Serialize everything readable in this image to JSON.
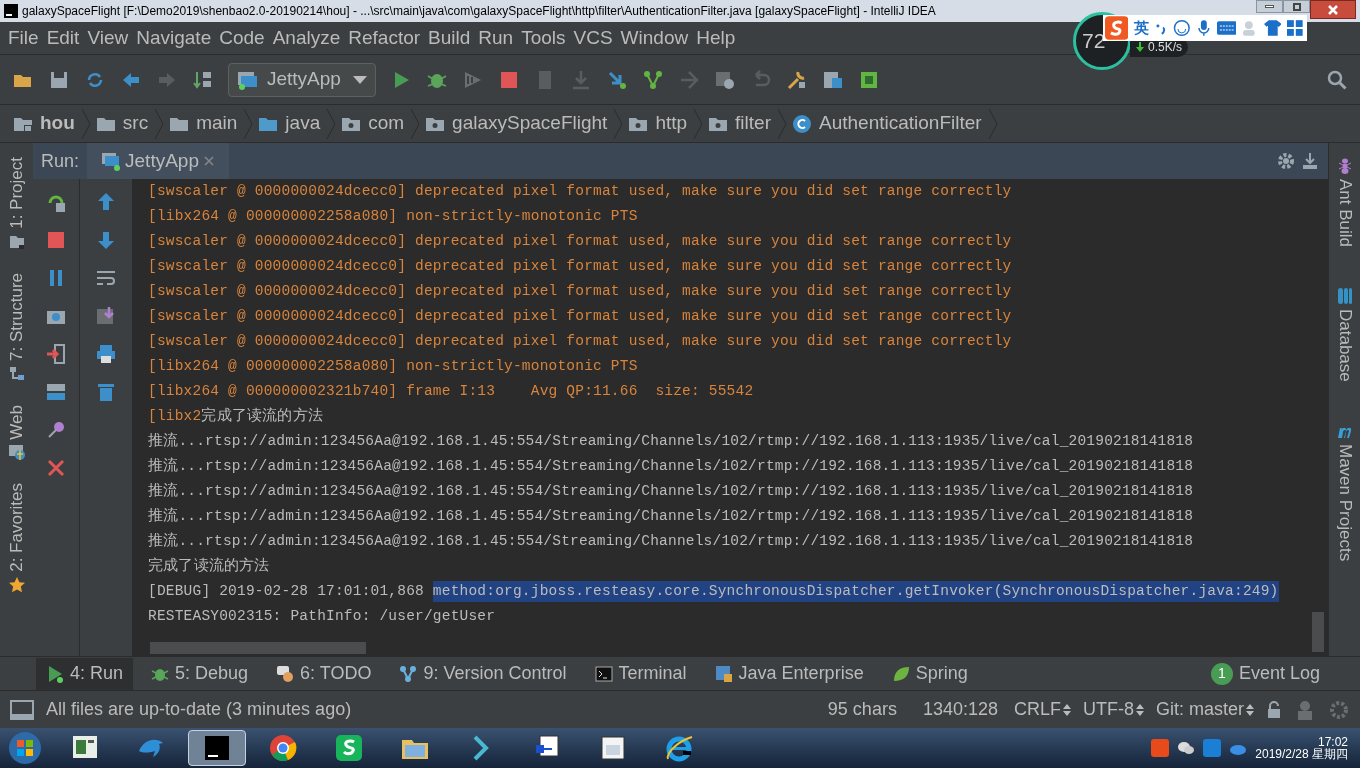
{
  "window": {
    "title": "galaxySpaceFlight [F:\\Demo2019\\shenbao2.0-20190214\\hou] - ...\\src\\main\\java\\com\\galaxySpaceFlight\\http\\filter\\AuthenticationFilter.java [galaxySpaceFlight] - IntelliJ IDEA"
  },
  "menu": [
    "File",
    "Edit",
    "View",
    "Navigate",
    "Code",
    "Analyze",
    "Refactor",
    "Build",
    "Run",
    "Tools",
    "VCS",
    "Window",
    "Help"
  ],
  "run_config": "JettyApp",
  "breadcrumbs": [
    {
      "label": "hou",
      "kind": "module"
    },
    {
      "label": "src",
      "kind": "folder"
    },
    {
      "label": "main",
      "kind": "folder"
    },
    {
      "label": "java",
      "kind": "source"
    },
    {
      "label": "com",
      "kind": "package"
    },
    {
      "label": "galaxySpaceFlight",
      "kind": "package"
    },
    {
      "label": "http",
      "kind": "package"
    },
    {
      "label": "filter",
      "kind": "package"
    },
    {
      "label": "AuthenticationFilter",
      "kind": "class"
    }
  ],
  "left_tools": [
    {
      "label": "1: Project",
      "kind": "project"
    },
    {
      "label": "7: Structure",
      "kind": "structure"
    },
    {
      "label": "Web",
      "kind": "web"
    },
    {
      "label": "2: Favorites",
      "kind": "favorites"
    }
  ],
  "right_tools": [
    {
      "label": "Ant Build",
      "kind": "ant"
    },
    {
      "label": "Database",
      "kind": "database"
    },
    {
      "label": "Maven Projects",
      "kind": "maven"
    }
  ],
  "run_panel": {
    "label": "Run:",
    "tab": "JettyApp",
    "lines": [
      {
        "parts": [
          {
            "kind": "error",
            "text": "[swscaler @ 0000000024dcecc0] deprecated pixel format used, make sure you did set range correctly"
          }
        ]
      },
      {
        "parts": [
          {
            "kind": "error",
            "text": "[libx264 @ 000000002258a080] non-strictly-monotonic PTS"
          }
        ]
      },
      {
        "parts": [
          {
            "kind": "error",
            "text": "[swscaler @ 0000000024dcecc0] deprecated pixel format used, make sure you did set range correctly"
          }
        ]
      },
      {
        "parts": [
          {
            "kind": "error",
            "text": "[swscaler @ 0000000024dcecc0] deprecated pixel format used, make sure you did set range correctly"
          }
        ]
      },
      {
        "parts": [
          {
            "kind": "error",
            "text": "[swscaler @ 0000000024dcecc0] deprecated pixel format used, make sure you did set range correctly"
          }
        ]
      },
      {
        "parts": [
          {
            "kind": "error",
            "text": "[swscaler @ 0000000024dcecc0] deprecated pixel format used, make sure you did set range correctly"
          }
        ]
      },
      {
        "parts": [
          {
            "kind": "error",
            "text": "[swscaler @ 0000000024dcecc0] deprecated pixel format used, make sure you did set range correctly"
          }
        ]
      },
      {
        "parts": [
          {
            "kind": "error",
            "text": "[libx264 @ 000000002258a080] non-strictly-monotonic PTS"
          }
        ]
      },
      {
        "parts": [
          {
            "kind": "error",
            "text": "[libx264 @ 000000002321b740] frame I:13    Avg QP:11.66  size: 55542"
          }
        ]
      },
      {
        "parts": [
          {
            "kind": "error",
            "text": "[libx2"
          },
          {
            "kind": "normal",
            "text": "完成了读流的方法"
          }
        ]
      },
      {
        "parts": [
          {
            "kind": "normal",
            "text": "推流...rtsp://admin:123456Aa@192.168.1.45:554/Streaming/Channels/102/rtmp://192.168.1.113:1935/live/cal_20190218141818"
          }
        ]
      },
      {
        "parts": [
          {
            "kind": "normal",
            "text": "推流...rtsp://admin:123456Aa@192.168.1.45:554/Streaming/Channels/102/rtmp://192.168.1.113:1935/live/cal_20190218141818"
          }
        ]
      },
      {
        "parts": [
          {
            "kind": "normal",
            "text": "推流...rtsp://admin:123456Aa@192.168.1.45:554/Streaming/Channels/102/rtmp://192.168.1.113:1935/live/cal_20190218141818"
          }
        ]
      },
      {
        "parts": [
          {
            "kind": "normal",
            "text": "推流...rtsp://admin:123456Aa@192.168.1.45:554/Streaming/Channels/102/rtmp://192.168.1.113:1935/live/cal_20190218141818"
          }
        ]
      },
      {
        "parts": [
          {
            "kind": "normal",
            "text": "推流...rtsp://admin:123456Aa@192.168.1.45:554/Streaming/Channels/102/rtmp://192.168.1.113:1935/live/cal_20190218141818"
          }
        ]
      },
      {
        "parts": [
          {
            "kind": "normal",
            "text": "完成了读流的方法"
          }
        ]
      },
      {
        "parts": [
          {
            "kind": "normal",
            "text": "[DEBUG] 2019-02-28 17:01:01,868 "
          },
          {
            "kind": "selected",
            "text": "method:org.jboss.resteasy.core.SynchronousDispatcher.getInvoker(SynchronousDispatcher.java:249)"
          }
        ]
      },
      {
        "parts": [
          {
            "kind": "normal",
            "text": "RESTEASY002315: PathInfo: /user/getUser"
          }
        ]
      }
    ]
  },
  "bottom_tools": [
    {
      "label": "4: Run",
      "kind": "run",
      "selected": true
    },
    {
      "label": "5: Debug",
      "kind": "debug",
      "selected": false
    },
    {
      "label": "6: TODO",
      "kind": "todo",
      "selected": false
    },
    {
      "label": "9: Version Control",
      "kind": "vcs",
      "selected": false
    },
    {
      "label": "Terminal",
      "kind": "terminal",
      "selected": false
    },
    {
      "label": "Java Enterprise",
      "kind": "javaee",
      "selected": false
    },
    {
      "label": "Spring",
      "kind": "spring",
      "selected": false
    }
  ],
  "event_log": {
    "count": "1",
    "label": "Event Log"
  },
  "status": {
    "message": "All files are up-to-date (3 minutes ago)",
    "chars": "95 chars",
    "position": "1340:128",
    "line_sep": "CRLF",
    "encoding": "UTF-8",
    "vcs": "Git: master"
  },
  "widget": {
    "percent": "72",
    "speed": "0.5K/s"
  },
  "ime": {
    "mode": "英"
  },
  "taskbar": [
    {
      "kind": "start",
      "selected": false
    },
    {
      "kind": "monitor",
      "selected": false
    },
    {
      "kind": "dolphin",
      "selected": false
    },
    {
      "kind": "intellij",
      "selected": true
    },
    {
      "kind": "chrome",
      "selected": false
    },
    {
      "kind": "sheets",
      "selected": false
    },
    {
      "kind": "explorer",
      "selected": false
    },
    {
      "kind": "arrow",
      "selected": false
    },
    {
      "kind": "network",
      "selected": false
    },
    {
      "kind": "window",
      "selected": false
    },
    {
      "kind": "ie",
      "selected": false
    }
  ],
  "clock": {
    "time": "17:02",
    "date": "2019/2/28 星期四"
  }
}
